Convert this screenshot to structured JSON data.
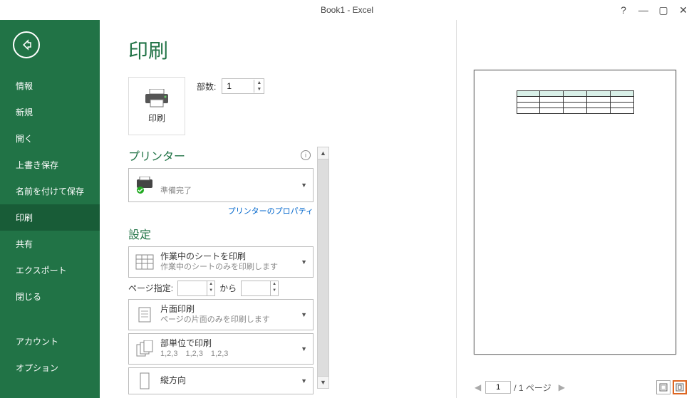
{
  "titlebar": {
    "title": "Book1 - Excel",
    "help": "?",
    "min": "—",
    "max": "▢",
    "close": "✕"
  },
  "sidebar": {
    "items": [
      {
        "label": "情報"
      },
      {
        "label": "新規"
      },
      {
        "label": "開く"
      },
      {
        "label": "上書き保存"
      },
      {
        "label": "名前を付けて保存"
      },
      {
        "label": "印刷",
        "active": true
      },
      {
        "label": "共有"
      },
      {
        "label": "エクスポート"
      },
      {
        "label": "閉じる"
      }
    ],
    "lower": [
      {
        "label": "アカウント"
      },
      {
        "label": "オプション"
      }
    ]
  },
  "heading": "印刷",
  "print_button": "印刷",
  "copies_label": "部数:",
  "copies_value": "1",
  "printer_section": "プリンター",
  "printer_status": "準備完了",
  "printer_props": "プリンターのプロパティ",
  "settings_section": "設定",
  "print_active": {
    "title": "作業中のシートを印刷",
    "sub": "作業中のシートのみを印刷します"
  },
  "pages_label": "ページ指定:",
  "pages_to": "から",
  "one_sided": {
    "title": "片面印刷",
    "sub": "ページの片面のみを印刷します"
  },
  "collated": {
    "title": "部単位で印刷",
    "sub": "1,2,3　1,2,3　1,2,3"
  },
  "orientation": {
    "title": "縦方向"
  },
  "footer": {
    "page_value": "1",
    "page_total": "1 ページ"
  }
}
